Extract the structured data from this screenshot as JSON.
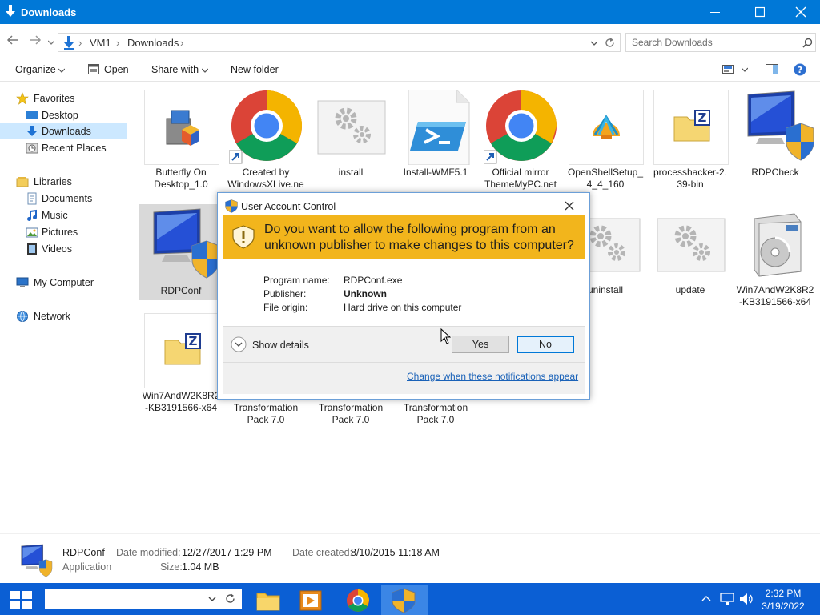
{
  "window": {
    "title": "Downloads",
    "min_label": "Minimize",
    "max_label": "Maximize",
    "close_label": "Close"
  },
  "address": {
    "crumbs": [
      "VM1",
      "Downloads"
    ],
    "search_placeholder": "Search Downloads"
  },
  "toolbar": {
    "organize": "Organize",
    "open": "Open",
    "share_with": "Share with",
    "new_folder": "New folder"
  },
  "nav": {
    "favorites": "Favorites",
    "desktop": "Desktop",
    "downloads": "Downloads",
    "recent_places": "Recent Places",
    "libraries": "Libraries",
    "documents": "Documents",
    "music": "Music",
    "pictures": "Pictures",
    "videos": "Videos",
    "my_computer": "My Computer",
    "network": "Network"
  },
  "files": {
    "f1": [
      "Butterfly On",
      "Desktop_1.0"
    ],
    "f2": [
      "Created by",
      "WindowsXLive.ne"
    ],
    "f3": [
      "install"
    ],
    "f4": [
      "Install-WMF5.1"
    ],
    "f5": [
      "Official mirror",
      "ThemeMyPC.net"
    ],
    "f6": [
      "OpenShellSetup_",
      "4_4_160"
    ],
    "f7": [
      "processhacker-2.",
      "39-bin"
    ],
    "f8": [
      "RDPCheck"
    ],
    "f9": [
      "RDPConf"
    ],
    "f10": [
      "uninstall"
    ],
    "f11": [
      "update"
    ],
    "f12": [
      "Win7AndW2K8R2",
      "-KB3191566-x64"
    ],
    "f13": [
      "Win7AndW2K8R2",
      "-KB3191566-x64"
    ],
    "f14": [
      "Transformation",
      "Pack 7.0"
    ],
    "f15": [
      "Transformation",
      "Pack 7.0"
    ],
    "f16": [
      "Transformation",
      "Pack 7.0"
    ]
  },
  "details": {
    "name": "RDPConf",
    "type": "Application",
    "date_modified_label": "Date modified:",
    "date_modified": "12/27/2017 1:29 PM",
    "size_label": "Size:",
    "size": "1.04 MB",
    "date_created_label": "Date created:",
    "date_created": "8/10/2015 11:18 AM"
  },
  "uac": {
    "title": "User Account Control",
    "question": "Do you want to allow the following program from an unknown publisher to make changes to this computer?",
    "program_name_label": "Program name:",
    "program_name": "RDPConf.exe",
    "publisher_label": "Publisher:",
    "publisher": "Unknown",
    "file_origin_label": "File origin:",
    "file_origin": "Hard drive on this computer",
    "show_details": "Show details",
    "yes": "Yes",
    "no": "No",
    "link": "Change when these notifications appear",
    "banner_color": "#f2b51c"
  },
  "taskbar": {
    "time": "2:32 PM",
    "date": "3/19/2022",
    "accent": "#0b5fd4"
  },
  "icons": [
    "folder-icon",
    "chrome-icon",
    "powershell-icon",
    "shield-icon",
    "gear-icon",
    "monitor-icon"
  ]
}
